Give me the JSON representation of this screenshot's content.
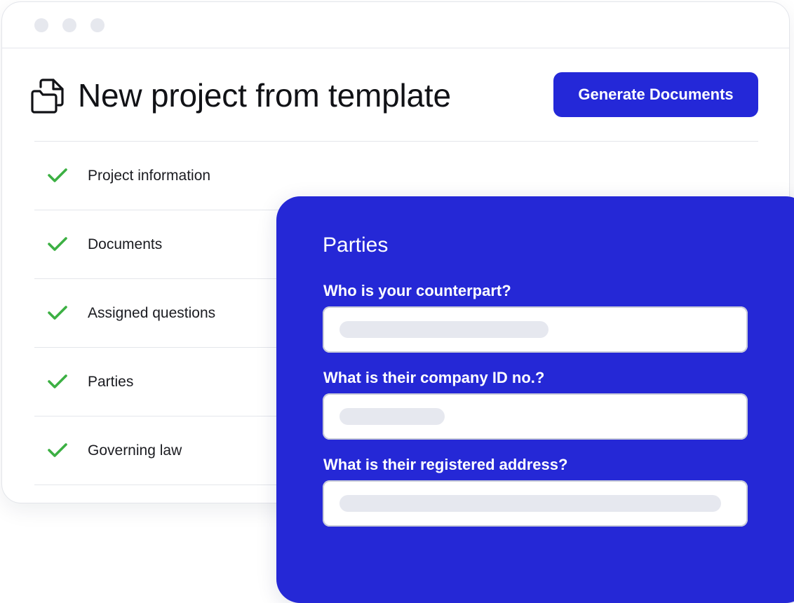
{
  "header": {
    "title": "New project from template",
    "generate_label": "Generate Documents"
  },
  "steps": [
    {
      "label": "Project information",
      "status": "complete"
    },
    {
      "label": "Documents",
      "status": "complete"
    },
    {
      "label": "Assigned questions",
      "status": "complete"
    },
    {
      "label": "Parties",
      "status": "complete"
    },
    {
      "label": "Governing law",
      "status": "complete"
    }
  ],
  "panel": {
    "title": "Parties",
    "questions": [
      {
        "label": "Who is your counterpart?"
      },
      {
        "label": "What is their company ID no.?"
      },
      {
        "label": "What is their registered address?"
      }
    ]
  },
  "icons": {
    "header": "files-icon",
    "step": "check-icon"
  },
  "colors": {
    "accent": "#2428d8",
    "check": "#3cb043",
    "placeholder": "#e6e8ef"
  }
}
